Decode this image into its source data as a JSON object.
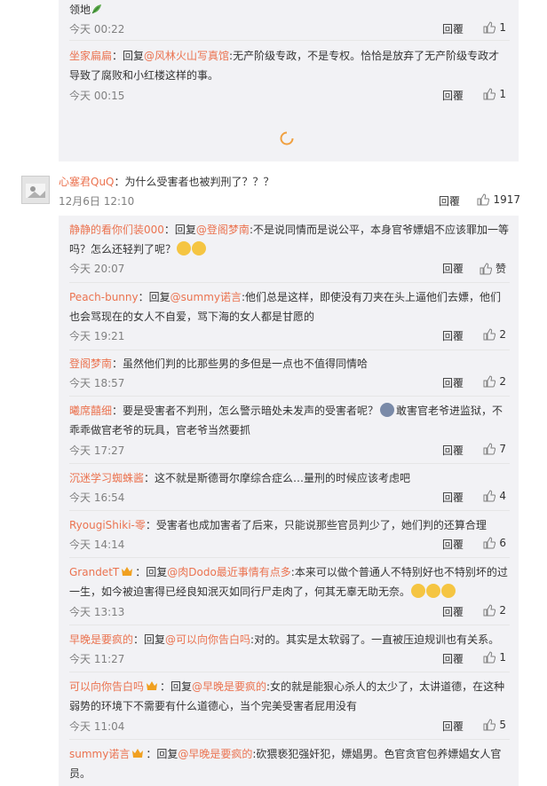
{
  "top_block": {
    "c1": {
      "text": "领地",
      "time": "今天 00:22",
      "reply": "回覆",
      "likes": "1"
    },
    "c2": {
      "user": "坐家扁扁",
      "reply_prefix": "：回复",
      "target": "@风林火山写真馆",
      "text": ":无产阶级专政，不是专权。恰恰是放弃了无产阶级专政才导致了腐败和小红楼这样的事。",
      "time": "今天 00:15",
      "reply": "回覆",
      "likes": "1"
    }
  },
  "main_comment": {
    "user": "心塞君QuQ",
    "text": "：为什么受害者也被判刑了？？？",
    "time": "12月6日 12:10",
    "reply": "回覆",
    "likes": "1917"
  },
  "sub_comments": [
    {
      "user": "静静的看你们装000",
      "reply_prefix": "：回复",
      "target": "@登阁梦南",
      "text": ":不是说同情而是说公平，本身官爷嫖娼不应该罪加一等吗？怎么还轻判了呢？",
      "emoji_count": 2,
      "time": "今天 20:07",
      "reply": "回覆",
      "likes": "赞"
    },
    {
      "user": "Peach-bunny",
      "reply_prefix": "：回复",
      "target": "@summy诺言",
      "text": ":他们总是这样，即使没有刀夹在头上逼他们去嫖，他们也会骂现在的女人不自爱，骂下海的女人都是甘愿的",
      "time": "今天 19:21",
      "reply": "回覆",
      "likes": "2"
    },
    {
      "user": "登阁梦南",
      "text": "：虽然他们判的比那些男的多但是一点也不值得同情哈",
      "time": "今天 18:57",
      "reply": "回覆",
      "likes": "2"
    },
    {
      "user": "曦席囍细",
      "text_a": "：要是受害者不判刑，怎么警示暗处未发声的受害者呢？",
      "text_b": "敢害官老爷进监狱，不乖乖做官老爷的玩具，官老爷当然要抓",
      "time": "今天 17:27",
      "reply": "回覆",
      "likes": "7"
    },
    {
      "user": "沉迷学习蜘蛛酱",
      "text": "：这不就是斯德哥尔摩综合症么…量刑的时候应该考虑吧",
      "time": "今天 16:54",
      "reply": "回覆",
      "likes": "4"
    },
    {
      "user": "RyougiShiki-零",
      "text": "：受害者也成加害者了后来，只能说那些官员判少了，她们判的还算合理",
      "time": "今天 14:14",
      "reply": "回覆",
      "likes": "6"
    },
    {
      "user": "GrandetT",
      "reply_prefix": "：回复",
      "target": "@肉Dodo最近事情有点多",
      "text": ":本来可以做个普通人不特别好也不特别坏的过一生，如今被迫害得已经良知泯灭如同行尸走肉了，何其无辜无助无奈。",
      "emoji_count": 3,
      "time": "今天 13:13",
      "reply": "回覆",
      "likes": "2"
    },
    {
      "user": "早晚是要疯的",
      "reply_prefix": "：回复",
      "target": "@可以向你告白吗",
      "text": ":对的。其实是太软弱了。一直被压迫规训也有关系。",
      "time": "今天 11:27",
      "reply": "回覆",
      "likes": "1"
    },
    {
      "user": "可以向你告白吗",
      "reply_prefix": "：回复",
      "target": "@早晚是要疯的",
      "text": ":女的就是能狠心杀人的太少了，太讲道德，在这种弱势的环境下不需要有什么道德心，当个完美受害者屁用没有",
      "time": "今天 11:04",
      "reply": "回覆",
      "likes": "5"
    },
    {
      "user": "summy诺言",
      "reply_prefix": "：回复",
      "target": "@早晚是要疯的",
      "text": ":砍猥亵犯强奸犯，嫖娼男。色官贪官包养嫖娼女人官员。"
    }
  ],
  "colors": {
    "username": "#eb7350",
    "meta": "#808080",
    "nest_bg": "#f2f2f5",
    "emoji": "#f5c542"
  }
}
